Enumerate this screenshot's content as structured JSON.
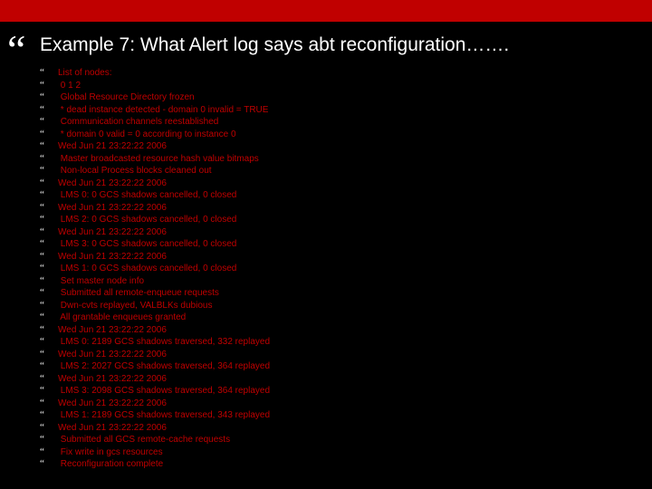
{
  "title": "Example 7: What Alert log says abt reconfiguration…….",
  "bullet": "“",
  "big_quote": "“",
  "lines": [
    "List of nodes:",
    " 0 1 2",
    " Global Resource Directory frozen",
    " * dead instance detected - domain 0 invalid = TRUE",
    " Communication channels reestablished",
    " * domain 0 valid = 0 according to instance 0",
    "Wed Jun 21 23:22:22 2006",
    " Master broadcasted resource hash value bitmaps",
    " Non-local Process blocks cleaned out",
    "Wed Jun 21 23:22:22 2006",
    " LMS 0: 0 GCS shadows cancelled, 0 closed",
    "Wed Jun 21 23:22:22 2006",
    " LMS 2: 0 GCS shadows cancelled, 0 closed",
    "Wed Jun 21 23:22:22 2006",
    " LMS 3: 0 GCS shadows cancelled, 0 closed",
    "Wed Jun 21 23:22:22 2006",
    " LMS 1: 0 GCS shadows cancelled, 0 closed",
    " Set master node info",
    " Submitted all remote-enqueue requests",
    " Dwn-cvts replayed, VALBLKs dubious",
    " All grantable enqueues granted",
    "Wed Jun 21 23:22:22 2006",
    " LMS 0: 2189 GCS shadows traversed, 332 replayed",
    "Wed Jun 21 23:22:22 2006",
    " LMS 2: 2027 GCS shadows traversed, 364 replayed",
    "Wed Jun 21 23:22:22 2006",
    " LMS 3: 2098 GCS shadows traversed, 364 replayed",
    "Wed Jun 21 23:22:22 2006",
    " LMS 1: 2189 GCS shadows traversed, 343 replayed",
    "Wed Jun 21 23:22:22 2006",
    " Submitted all GCS remote-cache requests",
    " Fix write in gcs resources",
    " Reconfiguration complete"
  ]
}
